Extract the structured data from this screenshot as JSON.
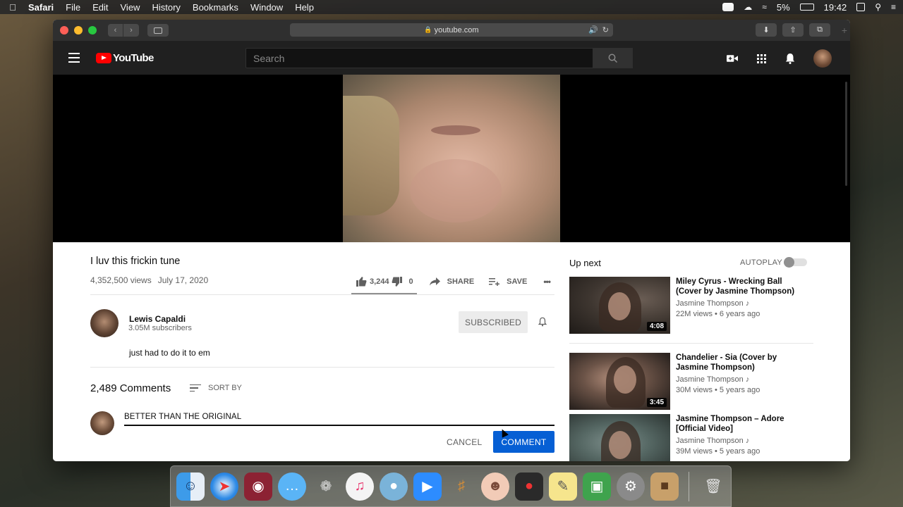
{
  "menubar": {
    "app": "Safari",
    "items": [
      "File",
      "Edit",
      "View",
      "History",
      "Bookmarks",
      "Window",
      "Help"
    ],
    "battery": "5%",
    "time": "19:42"
  },
  "browser": {
    "url": "youtube.com"
  },
  "masthead": {
    "logo_text": "YouTube",
    "search_placeholder": "Search"
  },
  "video": {
    "title": "I luv this frickin tune",
    "views": "4,352,500 views",
    "date": "July 17, 2020",
    "likes": "3,244",
    "dislikes": "0",
    "like_ratio": 1.0,
    "share_label": "SHARE",
    "save_label": "SAVE",
    "more_label": "•••"
  },
  "channel": {
    "name": "Lewis Capaldi",
    "subscribers": "3.05M subscribers",
    "subscribe_label": "SUBSCRIBED",
    "description": "just had to do it to em"
  },
  "comments": {
    "count": "2,489 Comments",
    "sort_label": "SORT BY",
    "draft": "BETTER THAN THE ORIGINAL",
    "cancel_label": "CANCEL",
    "submit_label": "COMMENT"
  },
  "up_next": {
    "heading": "Up next",
    "autoplay_label": "AUTOPLAY",
    "autoplay_on": false,
    "items": [
      {
        "title": "Miley Cyrus - Wrecking Ball (Cover by Jasmine Thompson)",
        "channel": "Jasmine Thompson",
        "stats": "22M views • 6 years ago",
        "duration": "4:08",
        "music_note": "♪"
      },
      {
        "title": "Chandelier - Sia (Cover by Jasmine Thompson)",
        "channel": "Jasmine Thompson",
        "stats": "30M views • 5 years ago",
        "duration": "3:45",
        "music_note": "♪"
      },
      {
        "title": "Jasmine Thompson – Adore [Official Video]",
        "channel": "Jasmine Thompson",
        "stats": "39M views • 5 years ago",
        "duration": "",
        "music_note": "♪"
      }
    ]
  },
  "dock": {
    "apps": [
      "finder-icon",
      "safari-icon",
      "photo-booth-icon",
      "messages-icon",
      "tree-icon",
      "music-icon",
      "sequel-icon",
      "zoom-icon",
      "garageband-icon",
      "face-icon",
      "voice-memos-icon",
      "stickies-icon",
      "preview-icon",
      "system-preferences-icon",
      "contacts-icon",
      "trash-icon"
    ]
  },
  "colors": {
    "accent": "#065fd4",
    "yt_red": "#ff0000",
    "masthead": "#202020"
  }
}
